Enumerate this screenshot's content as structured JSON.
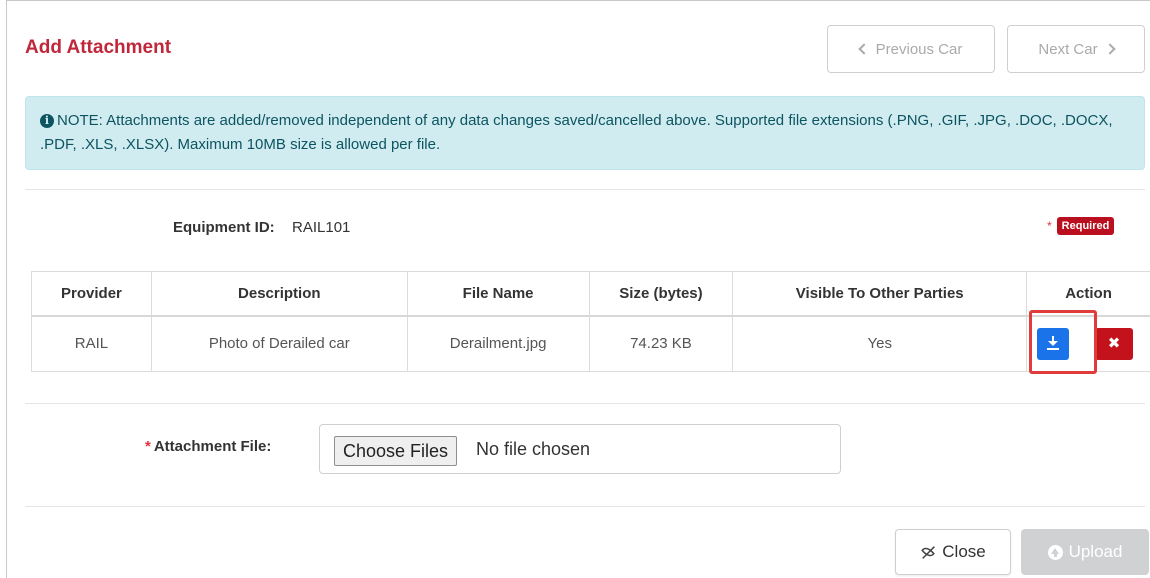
{
  "dialog": {
    "title": "Add Attachment",
    "prev_label": "Previous Car",
    "next_label": "Next Car"
  },
  "note": {
    "icon": "info-circle-icon",
    "text": "NOTE: Attachments are added/removed independent of any data changes saved/cancelled above. Supported file extensions (.PNG, .GIF, .JPG, .DOC, .DOCX, .PDF, .XLS, .XLSX). Maximum 10MB size is allowed per file."
  },
  "equipment": {
    "label": "Equipment ID:",
    "value": "RAIL101"
  },
  "required": {
    "star": "*",
    "label": "Required"
  },
  "table": {
    "headers": [
      "Provider",
      "Description",
      "File Name",
      "Size (bytes)",
      "Visible To Other Parties",
      "Action"
    ],
    "rows": [
      [
        "RAIL",
        "Photo of Derailed car",
        "Derailment.jpg",
        "74.23 KB",
        "Yes"
      ]
    ]
  },
  "attachment_file": {
    "star": "*",
    "label": "Attachment File:",
    "choose_label": "Choose Files",
    "status": "No file chosen"
  },
  "footer": {
    "close_label": "Close",
    "upload_label": "Upload"
  },
  "colors": {
    "title": "#c0273a",
    "note_bg": "#d1ecf1",
    "download_btn": "#1a73e8",
    "delete_btn": "#c4121c",
    "highlight": "#e03c3c",
    "upload_disabled": "#cfd1d3"
  }
}
